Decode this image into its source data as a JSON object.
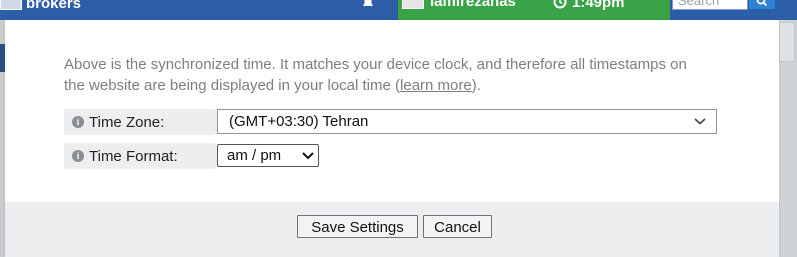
{
  "topbar": {
    "brand_label": "brokers",
    "username": "lamirezanas",
    "clock": "1:49pm",
    "search_placeholder": "Search"
  },
  "dialog": {
    "description_text": "Above is the synchronized time. It matches your device clock, and therefore all timestamps on the website are being displayed in your local time (",
    "learn_more": "learn more",
    "description_end": ").",
    "time_zone_label": "Time Zone:",
    "time_zone_value": "(GMT+03:30) Tehran",
    "time_format_label": "Time Format:",
    "time_format_value": "am / pm",
    "save_label": "Save Settings",
    "cancel_label": "Cancel"
  },
  "colors": {
    "topbar": "#2c5ea8",
    "green_tab": "#3aa348",
    "footer": "#eceef0"
  }
}
